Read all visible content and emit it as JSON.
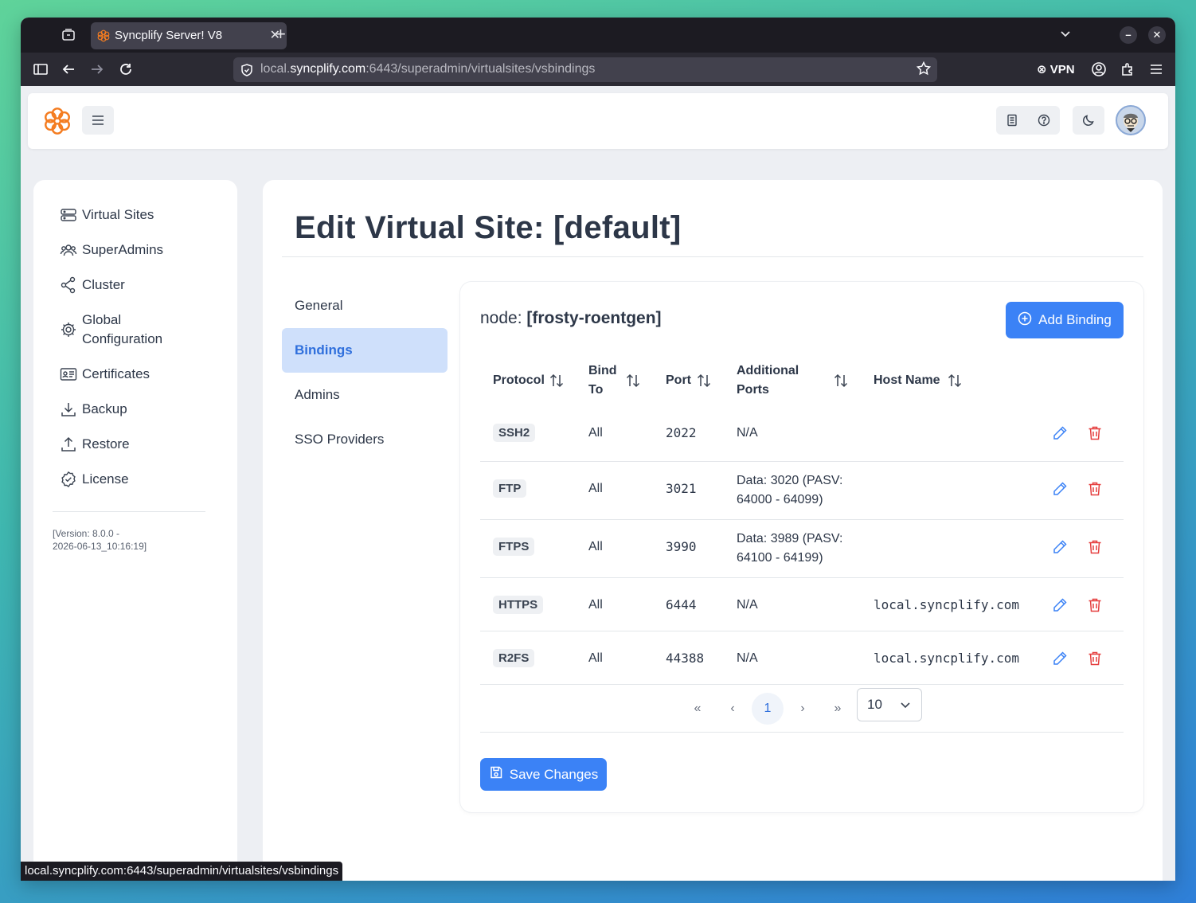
{
  "browser": {
    "tab_title": "Syncplify Server! V8",
    "url_host": "local.",
    "url_domain": "syncplify.com",
    "url_rest": ":6443/superadmin/virtualsites/vsbindings",
    "vpn_label": "VPN",
    "status_url": "local.syncplify.com:6443/superadmin/virtualsites/vsbindings"
  },
  "sidebar": {
    "items": [
      {
        "label": "Virtual Sites",
        "icon": "server-icon"
      },
      {
        "label": "SuperAdmins",
        "icon": "users-icon"
      },
      {
        "label": "Cluster",
        "icon": "share-icon"
      },
      {
        "label": "Global Configuration",
        "icon": "gear-icon"
      },
      {
        "label": "Certificates",
        "icon": "id-card-icon"
      },
      {
        "label": "Backup",
        "icon": "download-icon"
      },
      {
        "label": "Restore",
        "icon": "upload-icon"
      },
      {
        "label": "License",
        "icon": "badge-check-icon"
      }
    ],
    "version_line1": "[Version: 8.0.0 -",
    "version_line2": "2026-06-13_10:16:19]"
  },
  "main": {
    "title": "Edit Virtual Site: [default]",
    "subnav": [
      "General",
      "Bindings",
      "Admins",
      "SSO Providers"
    ],
    "active_subnav": "Bindings",
    "node_label": "node: ",
    "node_name": "[frosty-roentgen]",
    "add_binding_label": "Add Binding",
    "columns": [
      "Protocol",
      "Bind",
      "To",
      "Port",
      "Additional",
      "Ports",
      "Host Name"
    ],
    "rows": [
      {
        "protocol": "SSH2",
        "bind_to": "All",
        "port": "2022",
        "additional_l1": "N/A",
        "additional_l2": "",
        "host": ""
      },
      {
        "protocol": "FTP",
        "bind_to": "All",
        "port": "3021",
        "additional_l1": "Data: 3020 (PASV:",
        "additional_l2": "64000 - 64099)",
        "host": ""
      },
      {
        "protocol": "FTPS",
        "bind_to": "All",
        "port": "3990",
        "additional_l1": "Data: 3989 (PASV:",
        "additional_l2": "64100 - 64199)",
        "host": ""
      },
      {
        "protocol": "HTTPS",
        "bind_to": "All",
        "port": "6444",
        "additional_l1": "N/A",
        "additional_l2": "",
        "host": "local.syncplify.com"
      },
      {
        "protocol": "R2FS",
        "bind_to": "All",
        "port": "44388",
        "additional_l1": "N/A",
        "additional_l2": "",
        "host": "local.syncplify.com"
      }
    ],
    "pager": {
      "first": "«",
      "prev": "‹",
      "current": "1",
      "next": "›",
      "last": "»",
      "page_size": "10"
    },
    "save_label": "Save Changes"
  },
  "colors": {
    "accent": "#3b82f6",
    "delete": "#e53e3e",
    "logo": "#f47c20"
  }
}
